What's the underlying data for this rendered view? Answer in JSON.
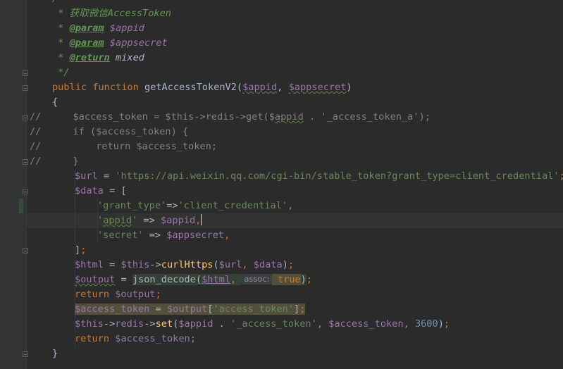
{
  "editor": {
    "lines": [
      {
        "gutter_mark": "",
        "segments": [
          {
            "cls": "dc",
            "text": "/**"
          }
        ]
      },
      {
        "gutter_mark": "",
        "segments": [
          {
            "cls": "dc",
            "text": " * 获取微信AccessToken"
          }
        ]
      },
      {
        "gutter_mark": "",
        "segments": [
          {
            "cls": "dc",
            "text": " * "
          },
          {
            "cls": "dt",
            "text": "@param"
          },
          {
            "cls": "dc",
            "text": " "
          },
          {
            "cls": "dv2",
            "text": "$appid"
          }
        ]
      },
      {
        "gutter_mark": "",
        "segments": [
          {
            "cls": "dc",
            "text": " * "
          },
          {
            "cls": "dt",
            "text": "@param"
          },
          {
            "cls": "dc",
            "text": " "
          },
          {
            "cls": "dv2",
            "text": "$appsecret"
          }
        ]
      },
      {
        "gutter_mark": "",
        "segments": [
          {
            "cls": "dc",
            "text": " * "
          },
          {
            "cls": "dt",
            "text": "@return"
          },
          {
            "cls": "dc",
            "text": " "
          },
          {
            "cls": "dm",
            "text": "mixed"
          }
        ]
      },
      {
        "gutter_mark": "",
        "segments": [
          {
            "cls": "dc",
            "text": " */"
          }
        ]
      },
      {
        "gutter_mark": "",
        "segments": [
          {
            "cls": "k",
            "text": "public function "
          },
          {
            "cls": "t",
            "text": "getAccessTokenV2("
          },
          {
            "cls": "v sq",
            "text": "$appid"
          },
          {
            "cls": "t",
            "text": ", "
          },
          {
            "cls": "v sq",
            "text": "$appsecret"
          },
          {
            "cls": "t",
            "text": ")"
          }
        ]
      },
      {
        "gutter_mark": "",
        "segments": [
          {
            "cls": "t",
            "text": "{"
          }
        ]
      },
      {
        "gutter_mark": "//",
        "segments": [
          {
            "cls": "c",
            "text": "        $access_token = $this->redis->get($"
          },
          {
            "cls": "c sq",
            "text": "appid"
          },
          {
            "cls": "c",
            "text": " . '_access_token_a');"
          }
        ]
      },
      {
        "gutter_mark": "//",
        "segments": [
          {
            "cls": "c",
            "text": "        if ($access_token) {"
          }
        ]
      },
      {
        "gutter_mark": "//",
        "segments": [
          {
            "cls": "c",
            "text": "            return $access_token;"
          }
        ]
      },
      {
        "gutter_mark": "//",
        "segments": [
          {
            "cls": "c",
            "text": "        }"
          }
        ]
      },
      {
        "gutter_mark": "",
        "segments": [
          {
            "cls": "v",
            "text": "$url"
          },
          {
            "cls": "t",
            "text": " = "
          },
          {
            "cls": "s",
            "text": "'https://api.weixin.qq.com/cgi-bin/stable_token?grant_type=client_credential'"
          },
          {
            "cls": "k",
            "text": ";"
          }
        ]
      },
      {
        "gutter_mark": "",
        "segments": [
          {
            "cls": "v",
            "text": "$data"
          },
          {
            "cls": "t",
            "text": " = ["
          }
        ]
      },
      {
        "gutter_mark": "",
        "segments": [
          {
            "cls": "s",
            "text": "'grant_type'"
          },
          {
            "cls": "t",
            "text": "=>"
          },
          {
            "cls": "s",
            "text": "'client_credential'"
          },
          {
            "cls": "k",
            "text": ","
          }
        ]
      },
      {
        "gutter_mark": "",
        "segments": [
          {
            "cls": "s",
            "text": "'"
          },
          {
            "cls": "s sq",
            "text": "appid"
          },
          {
            "cls": "s",
            "text": "'"
          },
          {
            "cls": "t",
            "text": " => "
          },
          {
            "cls": "v",
            "text": "$appid"
          },
          {
            "cls": "k",
            "text": ","
          },
          {
            "cls": "caret",
            "text": ""
          }
        ]
      },
      {
        "gutter_mark": "",
        "segments": [
          {
            "cls": "s",
            "text": "'secret'"
          },
          {
            "cls": "t",
            "text": " => "
          },
          {
            "cls": "v",
            "text": "$appsecret"
          },
          {
            "cls": "k",
            "text": ","
          }
        ]
      },
      {
        "gutter_mark": "",
        "segments": [
          {
            "cls": "t",
            "text": "]"
          },
          {
            "cls": "k",
            "text": ";"
          }
        ]
      },
      {
        "gutter_mark": "",
        "segments": [
          {
            "cls": "v",
            "text": "$html"
          },
          {
            "cls": "t",
            "text": " = "
          },
          {
            "cls": "v",
            "text": "$this"
          },
          {
            "cls": "t",
            "text": "->"
          },
          {
            "cls": "fn",
            "text": "curlHttps"
          },
          {
            "cls": "t",
            "text": "("
          },
          {
            "cls": "v",
            "text": "$url"
          },
          {
            "cls": "k",
            "text": ", "
          },
          {
            "cls": "v",
            "text": "$data"
          },
          {
            "cls": "t",
            "text": ")"
          },
          {
            "cls": "k",
            "text": ";"
          }
        ]
      },
      {
        "gutter_mark": "",
        "segments": [
          {
            "cls": "v sq",
            "text": "$output"
          },
          {
            "cls": "t",
            "text": " = "
          },
          {
            "cls": "t hl",
            "text": "json_decode("
          },
          {
            "cls": "v ul hl",
            "text": "$html"
          },
          {
            "cls": "k hl",
            "text": ", "
          },
          {
            "cls": "hint",
            "text": "assoc:"
          },
          {
            "cls": "k hl2",
            "text": " true"
          },
          {
            "cls": "t hl",
            "text": ")"
          },
          {
            "cls": "k",
            "text": ";"
          }
        ]
      },
      {
        "gutter_mark": "",
        "segments": [
          {
            "cls": "k",
            "text": "return "
          },
          {
            "cls": "v",
            "text": "$output"
          },
          {
            "cls": "k",
            "text": ";"
          }
        ]
      },
      {
        "gutter_mark": "",
        "segments": [
          {
            "cls": "v hl2",
            "text": "$access_token"
          },
          {
            "cls": "t hl2",
            "text": " = "
          },
          {
            "cls": "v hl2",
            "text": "$output"
          },
          {
            "cls": "t hl2",
            "text": "["
          },
          {
            "cls": "s hl2",
            "text": "'access_token'"
          },
          {
            "cls": "t hl2",
            "text": "]"
          },
          {
            "cls": "k hl2",
            "text": ";"
          }
        ]
      },
      {
        "gutter_mark": "",
        "segments": [
          {
            "cls": "v",
            "text": "$this"
          },
          {
            "cls": "t",
            "text": "->"
          },
          {
            "cls": "v",
            "text": "redis"
          },
          {
            "cls": "t",
            "text": "->"
          },
          {
            "cls": "fn",
            "text": "set"
          },
          {
            "cls": "t",
            "text": "("
          },
          {
            "cls": "v",
            "text": "$appid"
          },
          {
            "cls": "t",
            "text": " . "
          },
          {
            "cls": "s",
            "text": "'_access_token'"
          },
          {
            "cls": "k",
            "text": ", "
          },
          {
            "cls": "v",
            "text": "$access_token"
          },
          {
            "cls": "k",
            "text": ", "
          },
          {
            "cls": "n",
            "text": "3600"
          },
          {
            "cls": "t",
            "text": ")"
          },
          {
            "cls": "k",
            "text": ";"
          }
        ]
      },
      {
        "gutter_mark": "",
        "segments": [
          {
            "cls": "k",
            "text": "return "
          },
          {
            "cls": "v",
            "text": "$access_token"
          },
          {
            "cls": "k",
            "text": ";"
          }
        ]
      },
      {
        "gutter_mark": "",
        "segments": [
          {
            "cls": "t",
            "text": "}"
          }
        ]
      }
    ]
  }
}
